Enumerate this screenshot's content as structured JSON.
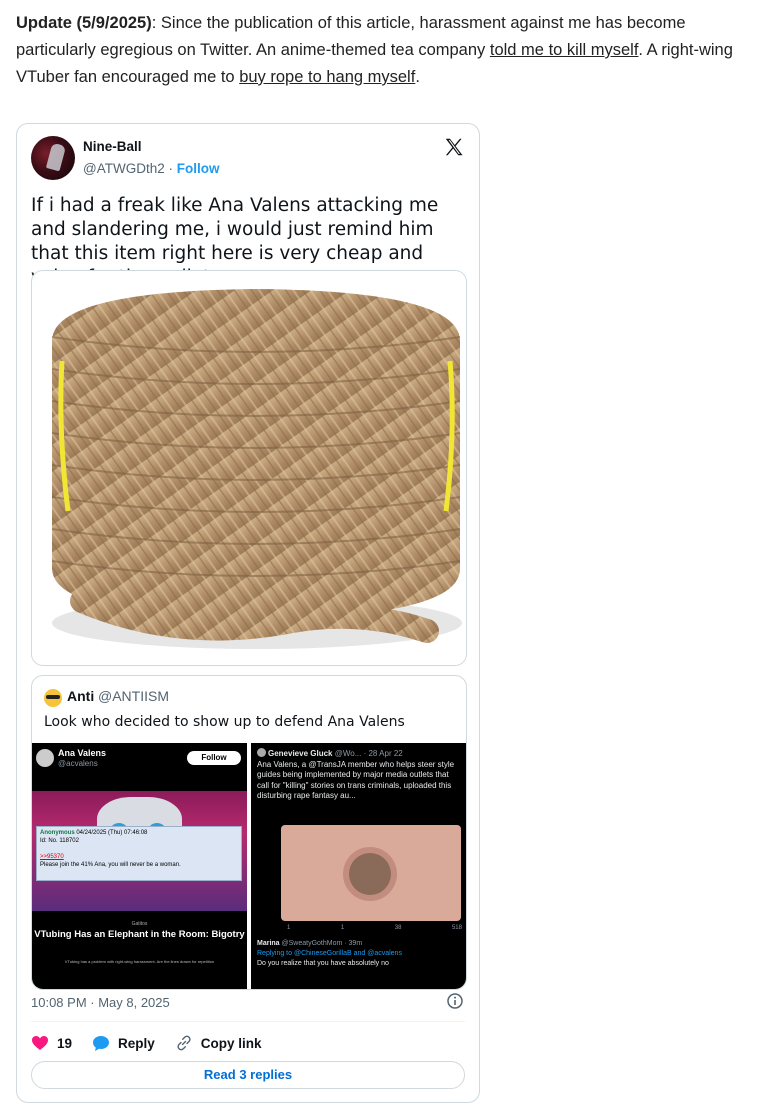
{
  "article": {
    "update_label": "Update (5/9/2025)",
    "text_1": ": Since the publication of this article, harassment against me has become particularly egregious on Twitter. An anime-themed tea company ",
    "link_1": "told me to kill myself",
    "text_2": ". A right-wing VTuber fan encouraged me to ",
    "link_2": "buy rope to hang myself",
    "text_3": "."
  },
  "tweet": {
    "author_name": "Nine-Ball",
    "author_handle": "@ATWGDth2",
    "dot": " · ",
    "follow_label": "Follow",
    "text": "If i had a freak like Ana Valens attacking me and slandering me, i would just remind him that this item right here is very cheap and value for the wallet:",
    "timestamp": "10:08 PM · May 8, 2025",
    "likes": "19",
    "reply_label": "Reply",
    "copy_link_label": "Copy link",
    "read_replies_label": "Read 3 replies"
  },
  "quote": {
    "name": "Anti",
    "handle": "@ANTIISM",
    "text": "Look who decided to show up to defend Ana Valens",
    "left_panel": {
      "name": "Ana Valens",
      "handle": "@acvalens",
      "follow": "Follow",
      "post_header_name": "Anonymous",
      "post_header_date": "04/24/2025 (Thu) 07:46:08",
      "post_id_label": "Id:",
      "post_no": "No. 118702",
      "post_link": ">>95370",
      "post_text": "Please join the 41% Ana, you will never be a woman.",
      "caption_top": "Gatitos",
      "caption": "VTubing Has an Elephant in the Room: Bigotry",
      "caption_sub": "VTubing has a problem with right-wing harassment. Are the lines drawn for repetition"
    },
    "right_panel": {
      "name": "Genevieve Gluck",
      "meta": "@Wo... · 28 Apr 22",
      "text": "Ana Valens, a @TransJA member who helps steer style guides being implemented by major media outlets that call for \"killing\" stories on trans criminals, uploaded this disturbing rape fantasy au...",
      "stat_1": "1",
      "stat_2": "1",
      "stat_3": "38",
      "stat_4": "518",
      "reply_name": "Marina",
      "reply_meta": "@SweatyGothMom · 39m",
      "reply_to": "Replying to @ChineseGorillaB and @acvalens",
      "reply_text": "Do you realize that you have absolutely no"
    }
  },
  "colors": {
    "accent": "#1d9bf0",
    "like": "#f91880",
    "read_link": "#006fd6",
    "border": "#cfd9de"
  }
}
